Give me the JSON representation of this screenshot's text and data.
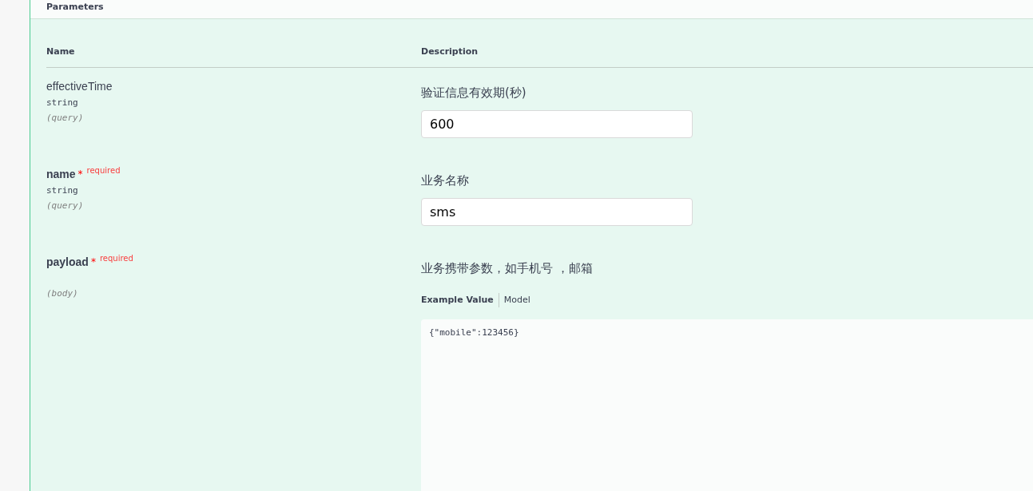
{
  "section": {
    "title": "Parameters"
  },
  "columns": [
    "Name",
    "Description"
  ],
  "parameters": [
    {
      "name": "effectiveTime",
      "required": false,
      "type": "string",
      "in": "(query)",
      "description": "验证信息有效期(秒)",
      "kind": "input",
      "value": "600"
    },
    {
      "name": "name",
      "required": true,
      "required_mark": "*",
      "required_label": "required",
      "type": "string",
      "in": "(query)",
      "description": "业务名称",
      "kind": "input",
      "value": "sms"
    },
    {
      "name": "payload",
      "required": true,
      "required_mark": "*",
      "required_label": "required",
      "in": "(body)",
      "description": "业务携带参数，如手机号 ，邮箱",
      "kind": "body",
      "tabs": [
        {
          "label": "Example Value",
          "selected": true
        },
        {
          "label": "Model",
          "selected": false
        }
      ],
      "example": "{\"mobile\":123456}"
    }
  ]
}
